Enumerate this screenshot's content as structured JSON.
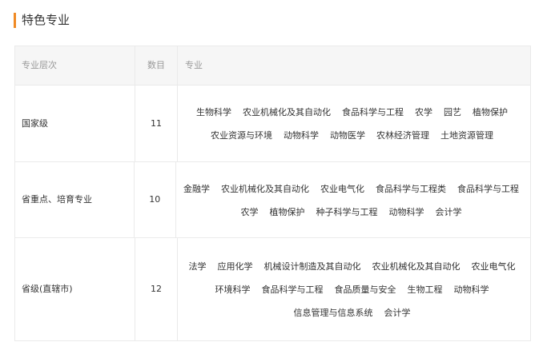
{
  "section": {
    "title": "特色专业",
    "accent_color": "#f08a24"
  },
  "table": {
    "headers": {
      "level": "专业层次",
      "count": "数目",
      "majors": "专业"
    },
    "rows": [
      {
        "level": "国家级",
        "count": "11",
        "major_lines": [
          [
            "生物科学",
            "农业机械化及其自动化",
            "食品科学与工程",
            "农学",
            "园艺",
            "植物保护"
          ],
          [
            "农业资源与环境",
            "动物科学",
            "动物医学",
            "农林经济管理",
            "土地资源管理"
          ]
        ]
      },
      {
        "level": "省重点、培育专业",
        "count": "10",
        "major_lines": [
          [
            "金融学",
            "农业机械化及其自动化",
            "农业电气化",
            "食品科学与工程类",
            "食品科学与工程"
          ],
          [
            "农学",
            "植物保护",
            "种子科学与工程",
            "动物科学",
            "会计学"
          ]
        ]
      },
      {
        "level": "省级(直辖市)",
        "count": "12",
        "major_lines": [
          [
            "法学",
            "应用化学",
            "机械设计制造及其自动化",
            "农业机械化及其自动化",
            "农业电气化"
          ],
          [
            "环境科学",
            "食品科学与工程",
            "食品质量与安全",
            "生物工程",
            "动物科学"
          ],
          [
            "信息管理与信息系统",
            "会计学"
          ]
        ]
      }
    ]
  }
}
